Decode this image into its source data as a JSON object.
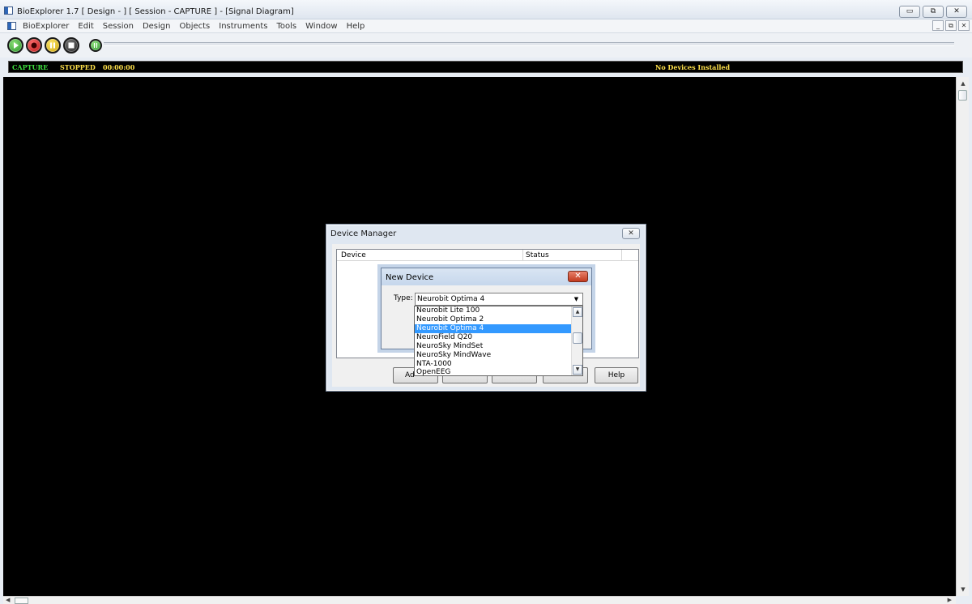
{
  "window": {
    "title": "BioExplorer 1.7  [ Design - ] [ Session - CAPTURE ] - [Signal Diagram]",
    "controls": [
      "▭",
      "⧉",
      "✕"
    ]
  },
  "menu": {
    "items": [
      "BioExplorer",
      "Edit",
      "Session",
      "Design",
      "Objects",
      "Instruments",
      "Tools",
      "Window",
      "Help"
    ],
    "mdi_controls": [
      "_",
      "⧉",
      "✕"
    ]
  },
  "toolbar": {
    "buttons": [
      "play-icon",
      "record-icon",
      "pause-icon",
      "stop-icon",
      "scan-icon"
    ]
  },
  "status": {
    "mode": "CAPTURE",
    "state": "STOPPED",
    "time": "00:00:00",
    "devices": "No Devices Installed",
    "colors": {
      "mode": "#3ee03e",
      "text": "#ffe14a",
      "background": "#000000"
    }
  },
  "device_manager": {
    "title": "Device Manager",
    "close": "✕",
    "columns": [
      "Device",
      "Status"
    ],
    "buttons": {
      "add": "Ad",
      "help": "Help"
    }
  },
  "new_device": {
    "title": "New Device",
    "close": "✕",
    "type_label": "Type:",
    "type_value": "Neurobit Optima 4",
    "options": [
      "Neurobit Lite 100",
      "Neurobit Optima 2",
      "Neurobit Optima 4",
      "NeuroField Q20",
      "NeuroSky MindSet",
      "NeuroSky MindWave",
      "NTA-1000",
      "OpenEEG"
    ],
    "selected_index": 2,
    "selection_color": "#3399ff"
  }
}
